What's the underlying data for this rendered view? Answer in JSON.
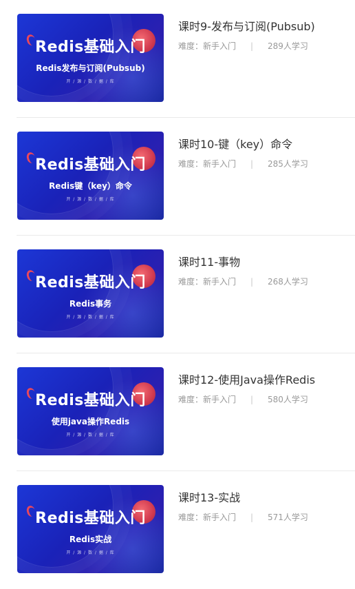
{
  "courses": [
    {
      "thumb_title": "Redis基础入门",
      "thumb_subtitle": "Redis发布与订阅(Pubsub)",
      "thumb_tagline": "开 / 源 / 数 / 据 / 库",
      "title": "课时9-发布与订阅(Pubsub)",
      "difficulty": "难度：新手入门",
      "separator": "|",
      "learners": "289人学习"
    },
    {
      "thumb_title": "Redis基础入门",
      "thumb_subtitle": "Redis键（key）命令",
      "thumb_tagline": "开 / 源 / 数 / 据 / 库",
      "title": "课时10-键（key）命令",
      "difficulty": "难度：新手入门",
      "separator": "|",
      "learners": "285人学习"
    },
    {
      "thumb_title": "Redis基础入门",
      "thumb_subtitle": "Redis事务",
      "thumb_tagline": "开 / 源 / 数 / 据 / 库",
      "title": "课时11-事物",
      "difficulty": "难度：新手入门",
      "separator": "|",
      "learners": "268人学习"
    },
    {
      "thumb_title": "Redis基础入门",
      "thumb_subtitle": "使用java操作Redis",
      "thumb_tagline": "开 / 源 / 数 / 据 / 库",
      "title": "课时12-使用Java操作Redis",
      "difficulty": "难度：新手入门",
      "separator": "|",
      "learners": "580人学习"
    },
    {
      "thumb_title": "Redis基础入门",
      "thumb_subtitle": "Redis实战",
      "thumb_tagline": "开 / 源 / 数 / 据 / 库",
      "title": "课时13-实战",
      "difficulty": "难度：新手入门",
      "separator": "|",
      "learners": "571人学习"
    }
  ]
}
